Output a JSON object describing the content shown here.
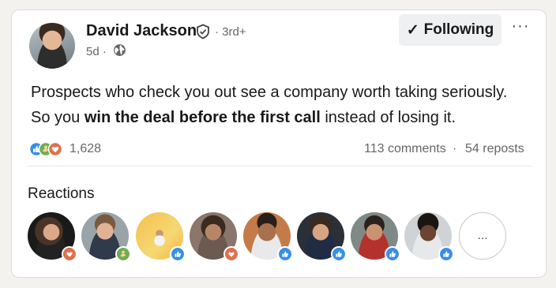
{
  "post": {
    "author": {
      "name": "David Jackson",
      "degree": "· 3rd+",
      "time": "5d ·"
    },
    "follow_label": "Following",
    "follow_check": "✓",
    "more_label": "···",
    "text": {
      "line1": "Prospects who check you out see a company worth taking seriously.",
      "line2_prefix": "So you ",
      "line2_bold": "win the deal before the first call",
      "line2_suffix": " instead of losing it."
    },
    "social": {
      "reaction_count": "1,628",
      "comments": "113 comments",
      "separator": "·",
      "reposts": "54 reposts"
    },
    "reactions_heading": "Reactions",
    "reactors_more_label": "...",
    "reactors": [
      {
        "badge": "love-icon"
      },
      {
        "badge": "support-icon"
      },
      {
        "badge": "like-icon"
      },
      {
        "badge": "love-icon"
      },
      {
        "badge": "like-icon"
      },
      {
        "badge": "like-icon"
      },
      {
        "badge": "like-icon"
      },
      {
        "badge": "like-icon"
      }
    ]
  },
  "colors": {
    "like": "#378fe9",
    "love": "#df704d",
    "support": "#6dae4f",
    "muted_text": "#666666"
  }
}
